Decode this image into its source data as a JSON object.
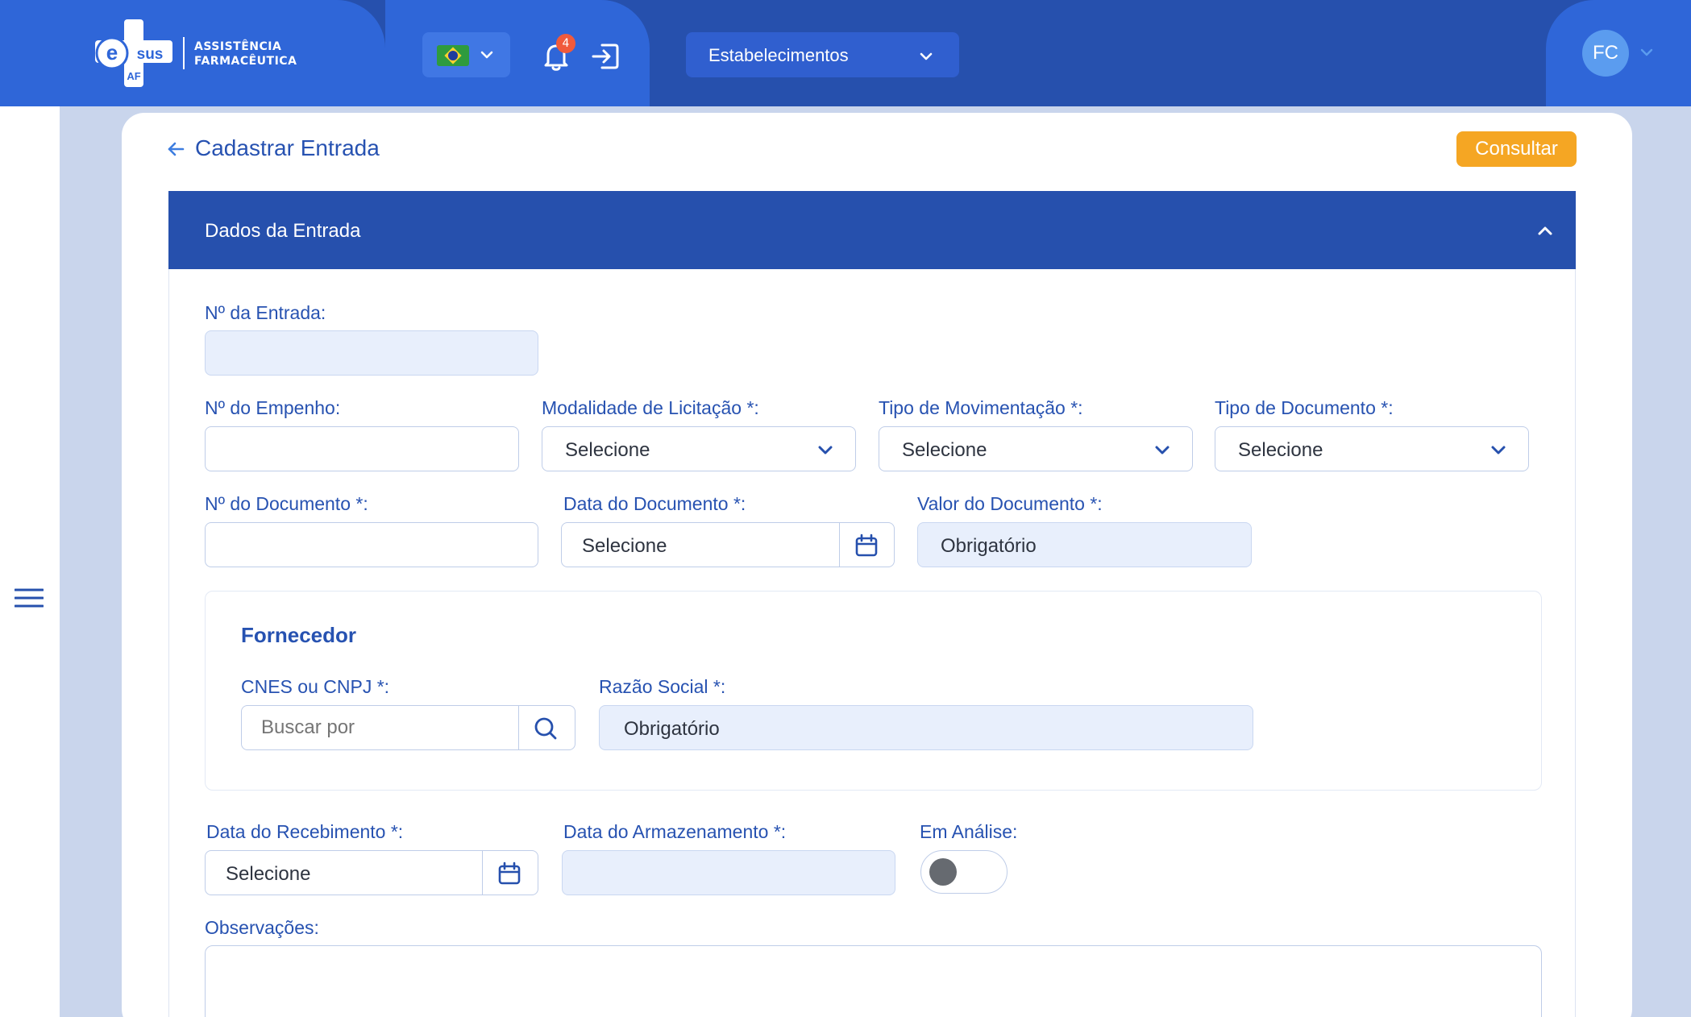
{
  "header": {
    "logo": {
      "brand_e": "e",
      "brand_sus": "sus",
      "brand_af": "AF",
      "line1": "ASSISTÊNCIA",
      "line2": "FARMACÊUTICA"
    },
    "language": {
      "flag": "brazil-flag-icon"
    },
    "notifications": {
      "count": "4"
    },
    "establishment_select": {
      "label": "Estabelecimentos"
    },
    "user": {
      "initials": "FC"
    }
  },
  "page": {
    "title": "Cadastrar Entrada",
    "consult_button": "Consultar"
  },
  "section": {
    "title": "Dados da Entrada"
  },
  "form": {
    "entry_number": {
      "label": "Nº da Entrada:",
      "value": ""
    },
    "commitment_number": {
      "label": "Nº do Empenho:",
      "value": ""
    },
    "bidding_modality": {
      "label": "Modalidade de Licitação *:",
      "value": "Selecione"
    },
    "movement_type": {
      "label": "Tipo de Movimentação *:",
      "value": "Selecione"
    },
    "document_type": {
      "label": "Tipo de Documento *:",
      "value": "Selecione"
    },
    "document_number": {
      "label": "Nº do Documento *:",
      "value": ""
    },
    "document_date": {
      "label": "Data do Documento *:",
      "value": "Selecione"
    },
    "document_value": {
      "label": "Valor do Documento *:",
      "value": "Obrigatório"
    },
    "supplier": {
      "title": "Fornecedor",
      "cnes_cnpj": {
        "label": "CNES ou CNPJ *:",
        "placeholder": "Buscar por"
      },
      "company_name": {
        "label": "Razão Social *:",
        "value": "Obrigatório"
      }
    },
    "receipt_date": {
      "label": "Data do Recebimento *:",
      "value": "Selecione"
    },
    "storage_date": {
      "label": "Data do Armazenamento *:",
      "value": ""
    },
    "under_analysis": {
      "label": "Em Análise:",
      "on": false
    },
    "notes": {
      "label": "Observações:",
      "value": ""
    }
  },
  "colors": {
    "primary": "#2650ad",
    "topbar_light": "#2f66d8",
    "accent_orange": "#f5a623",
    "readonly_fill": "#e8effc",
    "label_blue": "#2752b1"
  }
}
